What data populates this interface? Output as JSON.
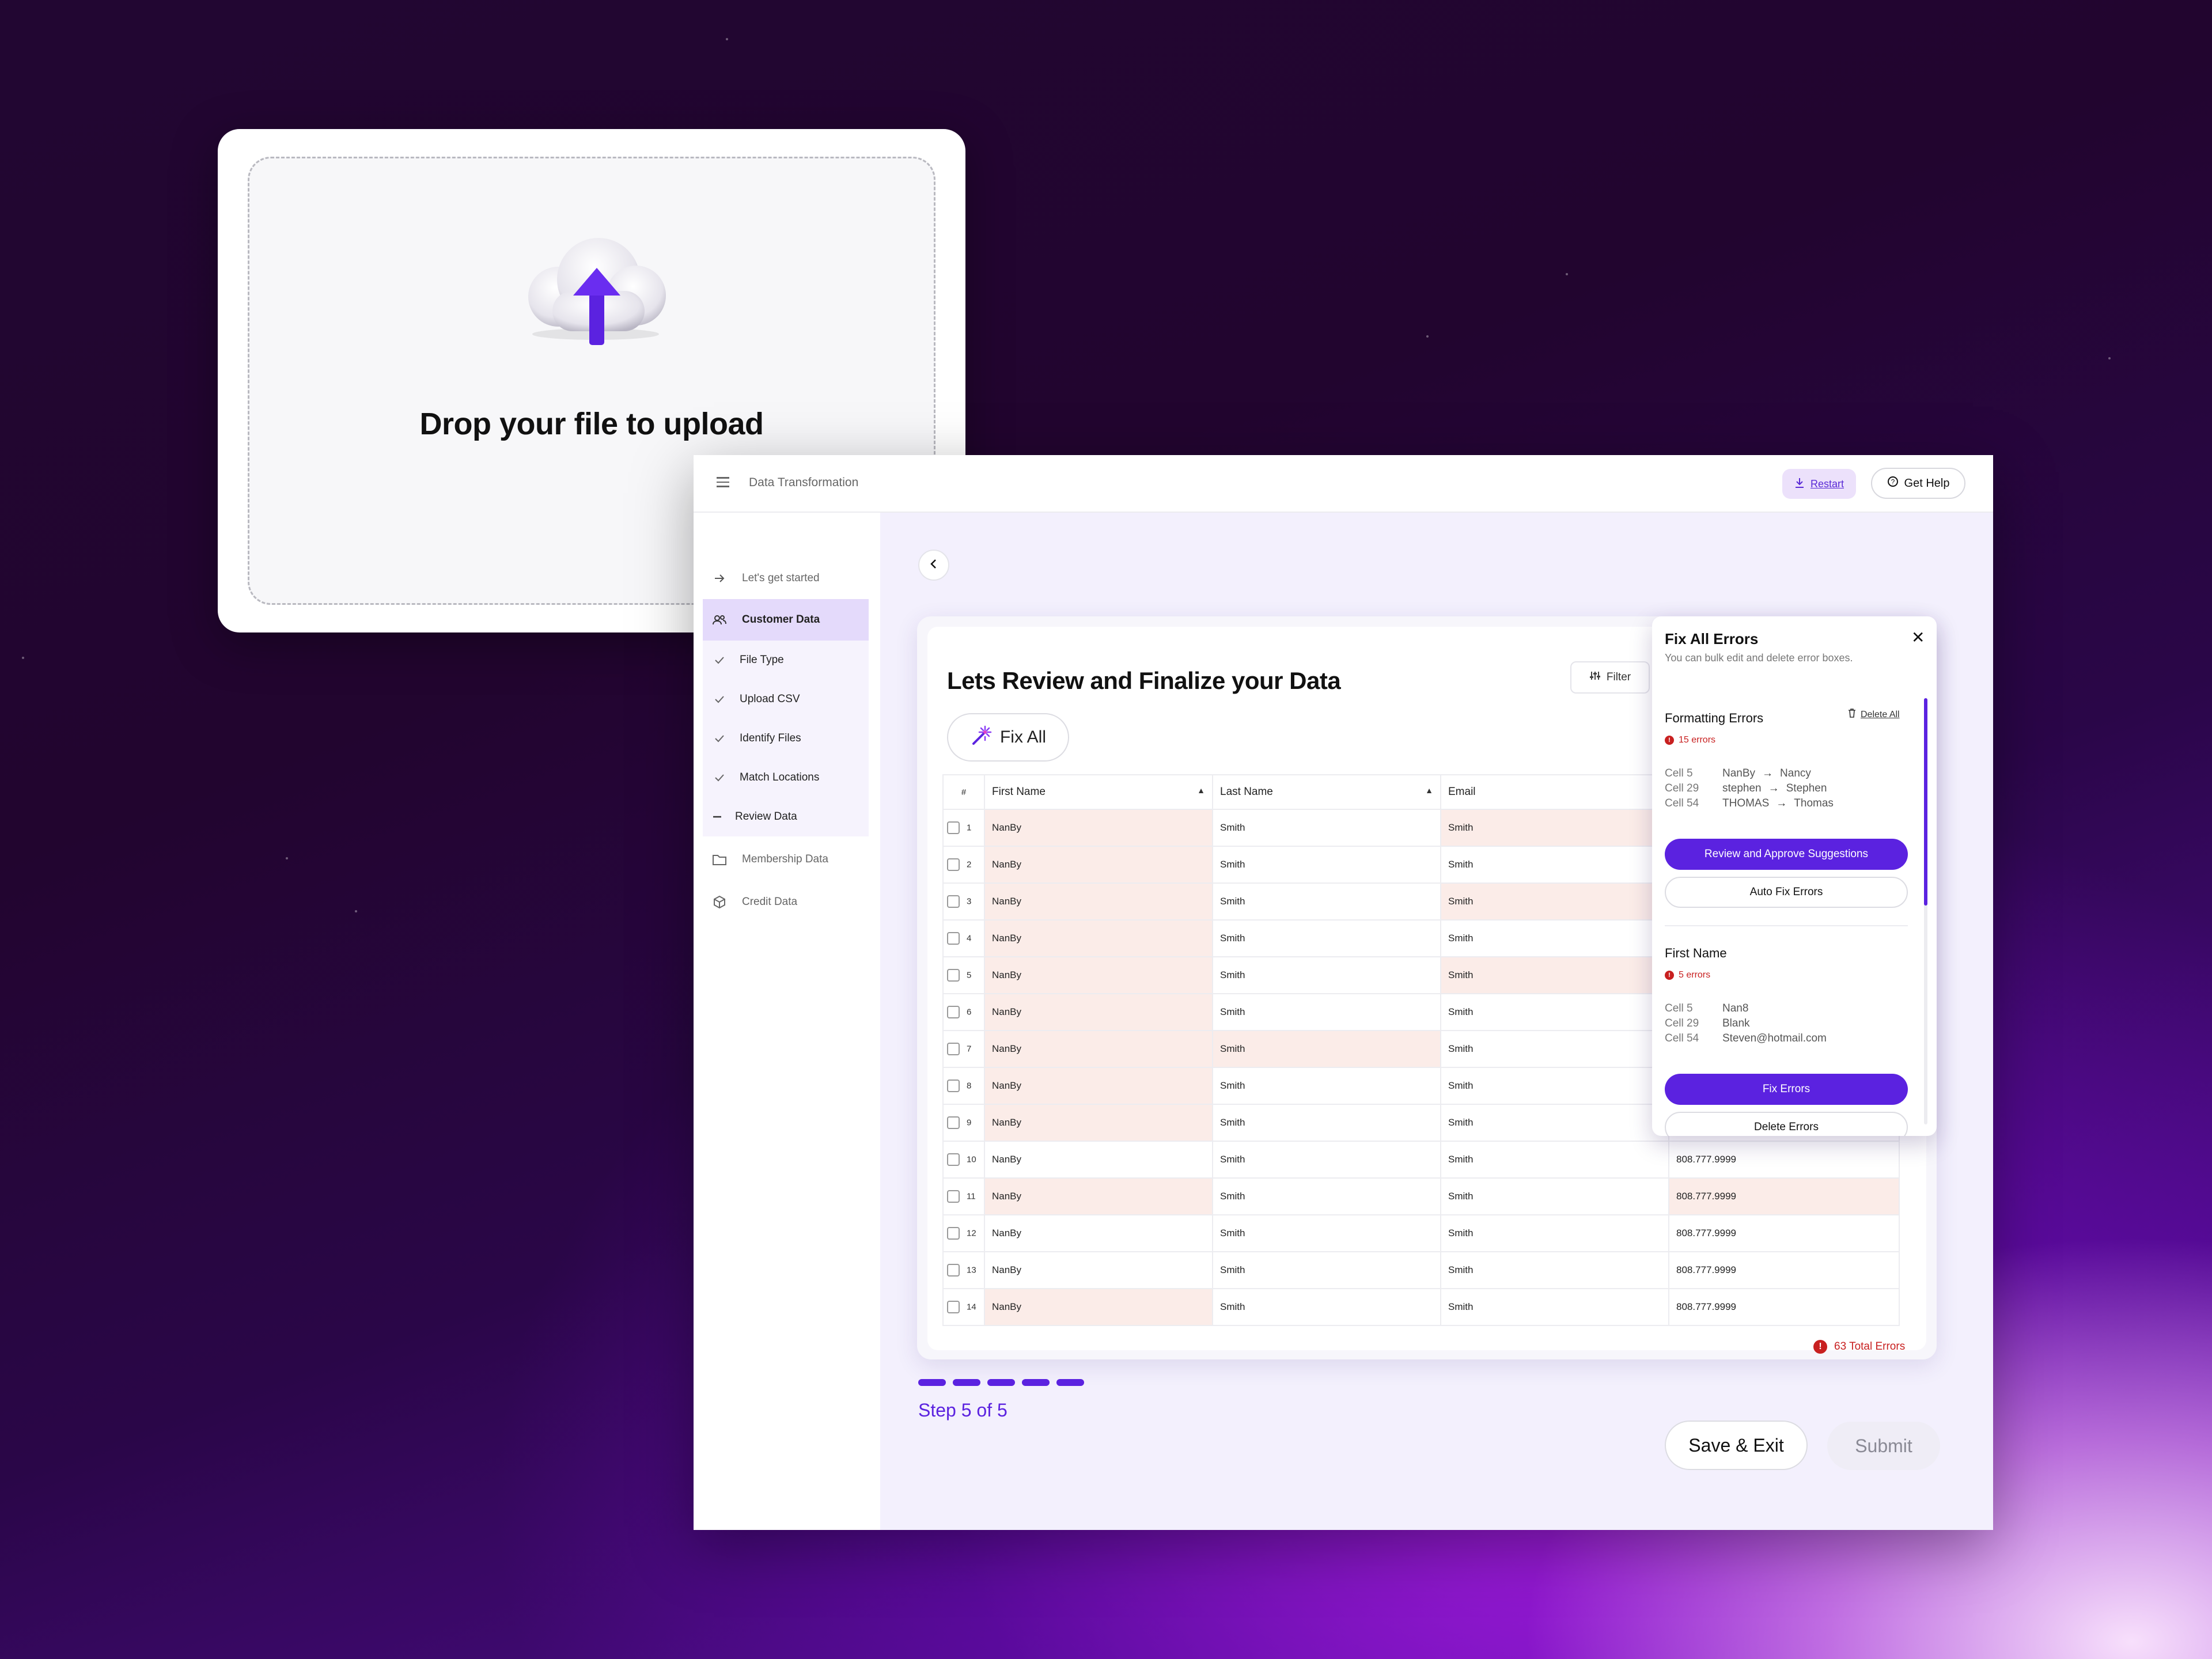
{
  "upload": {
    "title": "Drop your file to upload"
  },
  "header": {
    "title": "Data Transformation",
    "restart_label": "Restart",
    "help_label": "Get Help"
  },
  "sidebar": {
    "items": [
      {
        "label": "Let's get started",
        "icon": "arrow-right-icon"
      },
      {
        "label": "Customer Data",
        "icon": "users-icon",
        "active": true
      },
      {
        "label": "File Type",
        "icon": "check-icon"
      },
      {
        "label": "Upload CSV",
        "icon": "check-icon"
      },
      {
        "label": "Identify Files",
        "icon": "check-icon"
      },
      {
        "label": "Match Locations",
        "icon": "check-icon"
      },
      {
        "label": "Review Data",
        "icon": "minus-icon"
      },
      {
        "label": "Membership Data",
        "icon": "folder-icon"
      },
      {
        "label": "Credit Data",
        "icon": "cube-icon"
      }
    ]
  },
  "main": {
    "title": "Lets Review and Finalize your Data",
    "filter_label": "Filter",
    "fix_all_label": "Fix All",
    "columns": [
      "#",
      "First Name",
      "Last Name",
      "Email",
      ""
    ],
    "rows": [
      {
        "n": "1",
        "first": "NanBy",
        "last": "Smith",
        "email": "Smith",
        "phone": ""
      },
      {
        "n": "2",
        "first": "NanBy",
        "last": "Smith",
        "email": "Smith",
        "phone": ""
      },
      {
        "n": "3",
        "first": "NanBy",
        "last": "Smith",
        "email": "Smith",
        "phone": ""
      },
      {
        "n": "4",
        "first": "NanBy",
        "last": "Smith",
        "email": "Smith",
        "phone": ""
      },
      {
        "n": "5",
        "first": "NanBy",
        "last": "Smith",
        "email": "Smith",
        "phone": ""
      },
      {
        "n": "6",
        "first": "NanBy",
        "last": "Smith",
        "email": "Smith",
        "phone": ""
      },
      {
        "n": "7",
        "first": "NanBy",
        "last": "Smith",
        "email": "Smith",
        "phone": ""
      },
      {
        "n": "8",
        "first": "NanBy",
        "last": "Smith",
        "email": "Smith",
        "phone": ""
      },
      {
        "n": "9",
        "first": "NanBy",
        "last": "Smith",
        "email": "Smith",
        "phone": ""
      },
      {
        "n": "10",
        "first": "NanBy",
        "last": "Smith",
        "email": "Smith",
        "phone": "808.777.9999"
      },
      {
        "n": "11",
        "first": "NanBy",
        "last": "Smith",
        "email": "Smith",
        "phone": "808.777.9999"
      },
      {
        "n": "12",
        "first": "NanBy",
        "last": "Smith",
        "email": "Smith",
        "phone": "808.777.9999"
      },
      {
        "n": "13",
        "first": "NanBy",
        "last": "Smith",
        "email": "Smith",
        "phone": "808.777.9999"
      },
      {
        "n": "14",
        "first": "NanBy",
        "last": "Smith",
        "email": "Smith",
        "phone": "808.777.9999"
      }
    ],
    "total_errors": "63 Total Errors"
  },
  "fix_panel": {
    "title": "Fix All Errors",
    "subtitle": "You can bulk edit and delete error boxes.",
    "formatting": {
      "title": "Formatting Errors",
      "count": "15 errors",
      "delete_all": "Delete All",
      "rows": [
        {
          "cell": "Cell 5",
          "from": "NanBy",
          "to": "Nancy"
        },
        {
          "cell": "Cell 29",
          "from": "stephen",
          "to": "Stephen"
        },
        {
          "cell": "Cell 54",
          "from": "THOMAS",
          "to": "Thomas"
        }
      ],
      "primary": "Review and Approve Suggestions",
      "secondary": "Auto Fix Errors"
    },
    "first_name": {
      "title": "First Name",
      "count": "5 errors",
      "rows": [
        {
          "cell": "Cell 5",
          "value": "Nan8"
        },
        {
          "cell": "Cell 29",
          "value": "Blank"
        },
        {
          "cell": "Cell 54",
          "value": "Steven@hotmail.com"
        }
      ],
      "primary": "Fix Errors",
      "secondary": "Delete Errors"
    }
  },
  "footer": {
    "step_label": "Step 5 of 5",
    "save_exit": "Save & Exit",
    "submit": "Submit"
  },
  "colors": {
    "accent": "#5b22e0",
    "error": "#c82020",
    "error_cell": "#fbece8"
  }
}
